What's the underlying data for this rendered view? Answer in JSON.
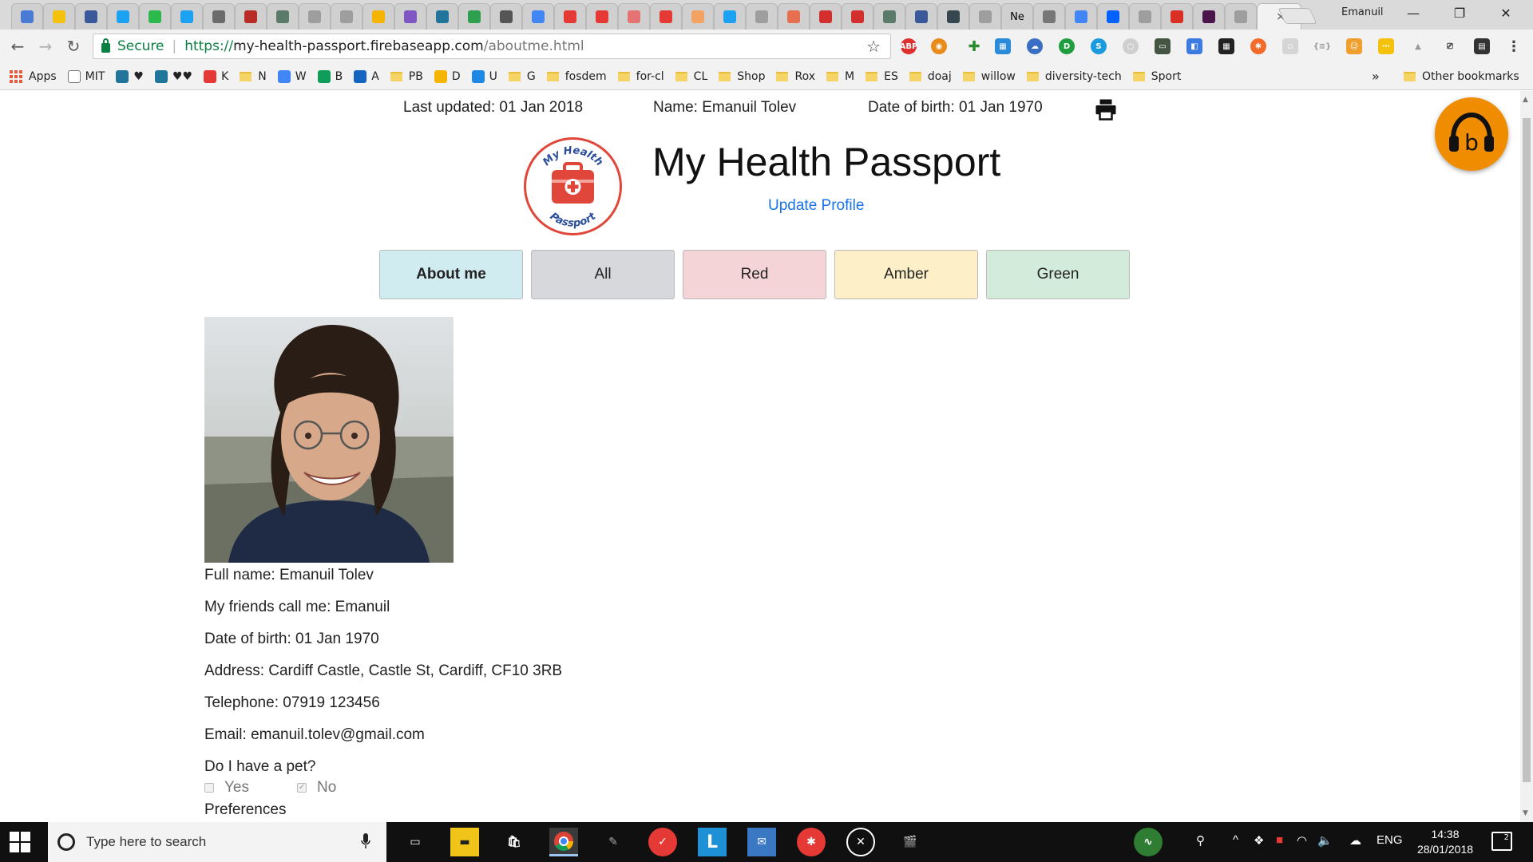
{
  "browser": {
    "tabs": {
      "favicons": [
        "cloud-icon",
        "keep-icon",
        "facebook-icon",
        "twitter-icon",
        "dollar-icon",
        "twitter-icon",
        "w-icon",
        "q-icon",
        "d-icon",
        "doc-icon",
        "doc-icon",
        "slides-icon",
        "list-icon",
        "wordpress-icon",
        "leaf-icon",
        "m-icon",
        "doc-blue-icon",
        "youtube-icon",
        "youtube-icon",
        "red-icon",
        "youtube-icon",
        "g-icon",
        "twitter-icon",
        "doc-icon",
        "bars-icon",
        "virgin-icon",
        "virgin-icon",
        "d-icon",
        "facebook-icon",
        "edit-icon",
        "doc-icon",
        "text-icon",
        "google-icon",
        "dropbox-icon",
        "doc-icon",
        "gmail-icon",
        "slack-icon",
        "doc-icon"
      ],
      "text_tab": "Ne",
      "active_close": "×"
    },
    "user_name": "Emanuil",
    "omnibox": {
      "secure_label": "Secure",
      "scheme": "https://",
      "host": "my-health-passport.firebaseapp.com",
      "path": "/aboutme.html"
    },
    "bookmarks": [
      {
        "label": "Apps",
        "icon": "apps-grid"
      },
      {
        "label": "MIT",
        "icon": "page"
      },
      {
        "label": "♥",
        "icon": "wordpress"
      },
      {
        "label": "♥♥",
        "icon": "wordpress"
      },
      {
        "label": "K",
        "icon": "youtube"
      },
      {
        "label": "N",
        "icon": "folder"
      },
      {
        "label": "W",
        "icon": "google"
      },
      {
        "label": "B",
        "icon": "sheets"
      },
      {
        "label": "A",
        "icon": "link"
      },
      {
        "label": "PB",
        "icon": "folder"
      },
      {
        "label": "D",
        "icon": "drive"
      },
      {
        "label": "U",
        "icon": "u"
      },
      {
        "label": "G",
        "icon": "folder"
      },
      {
        "label": "fosdem",
        "icon": "folder"
      },
      {
        "label": "for-cl",
        "icon": "folder"
      },
      {
        "label": "CL",
        "icon": "folder"
      },
      {
        "label": "Shop",
        "icon": "folder"
      },
      {
        "label": "Rox",
        "icon": "folder"
      },
      {
        "label": "M",
        "icon": "folder"
      },
      {
        "label": "ES",
        "icon": "folder"
      },
      {
        "label": "doaj",
        "icon": "folder"
      },
      {
        "label": "willow",
        "icon": "folder"
      },
      {
        "label": "diversity-tech",
        "icon": "folder"
      },
      {
        "label": "Sport",
        "icon": "folder"
      }
    ],
    "bookmarks_more": "»",
    "other_bookmarks": "Other bookmarks"
  },
  "page": {
    "meta": {
      "last_updated": "Last updated: 01 Jan 2018",
      "name": "Name: Emanuil Tolev",
      "dob": "Date of birth: 01 Jan 1970"
    },
    "logo_text_top": "My Health",
    "logo_text_bottom": "Passport",
    "title": "My Health Passport",
    "update_profile": "Update Profile",
    "tabs": [
      "About me",
      "All",
      "Red",
      "Amber",
      "Green"
    ],
    "profile": {
      "full_name": "Full name: Emanuil Tolev",
      "friends_call": "My friends call me: Emanuil",
      "dob": "Date of birth: 01 Jan 1970",
      "address": "Address: Cardiff Castle, Castle St, Cardiff, CF10 3RB",
      "telephone": "Telephone: 07919 123456",
      "email": "Email: emanuil.tolev@gmail.com",
      "pet_question": "Do I have a pet?",
      "pet_yes": "Yes",
      "pet_no": "No",
      "pet_value": "No",
      "preferences": "Preferences"
    }
  },
  "taskbar": {
    "search_placeholder": "Type here to search",
    "language": "ENG",
    "time": "14:38",
    "date": "28/01/2018",
    "notifications": "2"
  },
  "colors": {
    "accent_blue": "#1a73e8",
    "about_tab": "#d1ecf1",
    "all_tab": "#d6d8db",
    "red_tab": "#f5d4d7",
    "amber_tab": "#fdf0c9",
    "green_tab": "#d3ebdb",
    "logo_red": "#e0473a",
    "fab_orange": "#f08c00"
  }
}
